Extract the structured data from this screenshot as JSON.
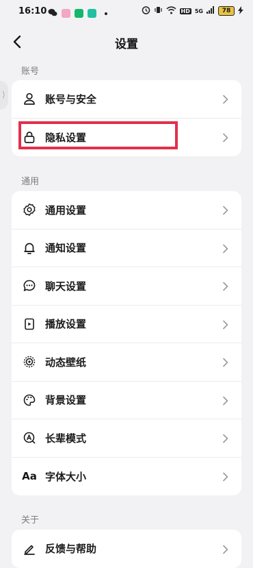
{
  "status_bar": {
    "time": "16:10",
    "network": "HD",
    "signal": "5G",
    "battery": "78"
  },
  "header": {
    "title": "设置"
  },
  "sections": [
    {
      "title": "账号",
      "items": [
        {
          "label": "账号与安全",
          "icon": "user-icon"
        },
        {
          "label": "隐私设置",
          "icon": "lock-icon"
        }
      ]
    },
    {
      "title": "通用",
      "items": [
        {
          "label": "通用设置",
          "icon": "gear-icon"
        },
        {
          "label": "通知设置",
          "icon": "bell-icon"
        },
        {
          "label": "聊天设置",
          "icon": "chat-icon"
        },
        {
          "label": "播放设置",
          "icon": "play-icon"
        },
        {
          "label": "动态壁纸",
          "icon": "wallpaper-icon"
        },
        {
          "label": "背景设置",
          "icon": "palette-icon"
        },
        {
          "label": "长辈模式",
          "icon": "elder-mode-icon"
        },
        {
          "label": "字体大小",
          "icon": "font-size-icon",
          "glyph": "Aa"
        }
      ]
    },
    {
      "title": "关于",
      "items": [
        {
          "label": "反馈与帮助",
          "icon": "pen-icon"
        }
      ]
    }
  ]
}
